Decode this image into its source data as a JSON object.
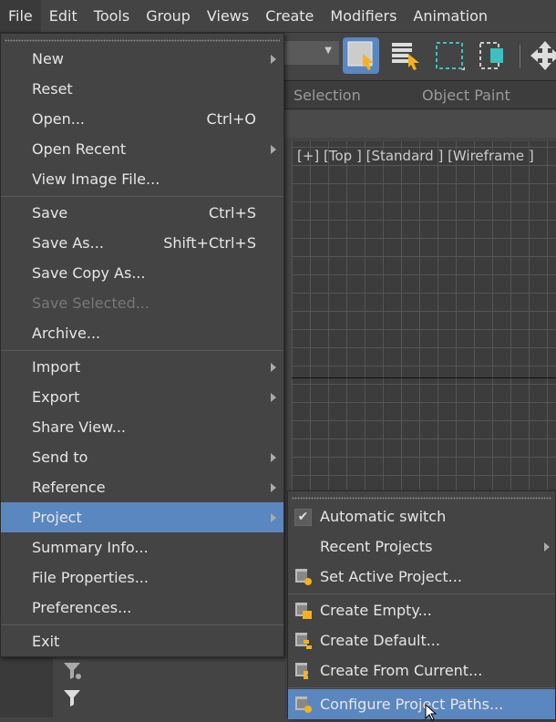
{
  "menubar": {
    "items": [
      "File",
      "Edit",
      "Tools",
      "Group",
      "Views",
      "Create",
      "Modifiers",
      "Animation"
    ]
  },
  "ribbon": {
    "selection": "Selection",
    "object_paint": "Object Paint"
  },
  "viewport": {
    "label": "[+] [Top ] [Standard ] [Wireframe ]"
  },
  "file_menu": {
    "new": "New",
    "reset": "Reset",
    "open": "Open...",
    "open_shortcut": "Ctrl+O",
    "open_recent": "Open Recent",
    "view_image": "View Image File...",
    "save": "Save",
    "save_shortcut": "Ctrl+S",
    "save_as": "Save As...",
    "save_as_shortcut": "Shift+Ctrl+S",
    "save_copy": "Save Copy As...",
    "save_selected": "Save Selected...",
    "archive": "Archive...",
    "import": "Import",
    "export": "Export",
    "share_view": "Share View...",
    "send_to": "Send to",
    "reference": "Reference",
    "project": "Project",
    "summary": "Summary Info...",
    "file_properties": "File Properties...",
    "preferences": "Preferences...",
    "exit": "Exit"
  },
  "project_menu": {
    "automatic_switch": "Automatic switch",
    "automatic_switch_checked": true,
    "recent_projects": "Recent Projects",
    "set_active": "Set Active Project...",
    "create_empty": "Create Empty...",
    "create_default": "Create Default...",
    "create_from_current": "Create From Current...",
    "configure_paths": "Configure Project Paths..."
  },
  "colors": {
    "highlight": "#5b87c0",
    "accent_yellow": "#f5b21b",
    "accent_teal": "#3fbfbf"
  }
}
